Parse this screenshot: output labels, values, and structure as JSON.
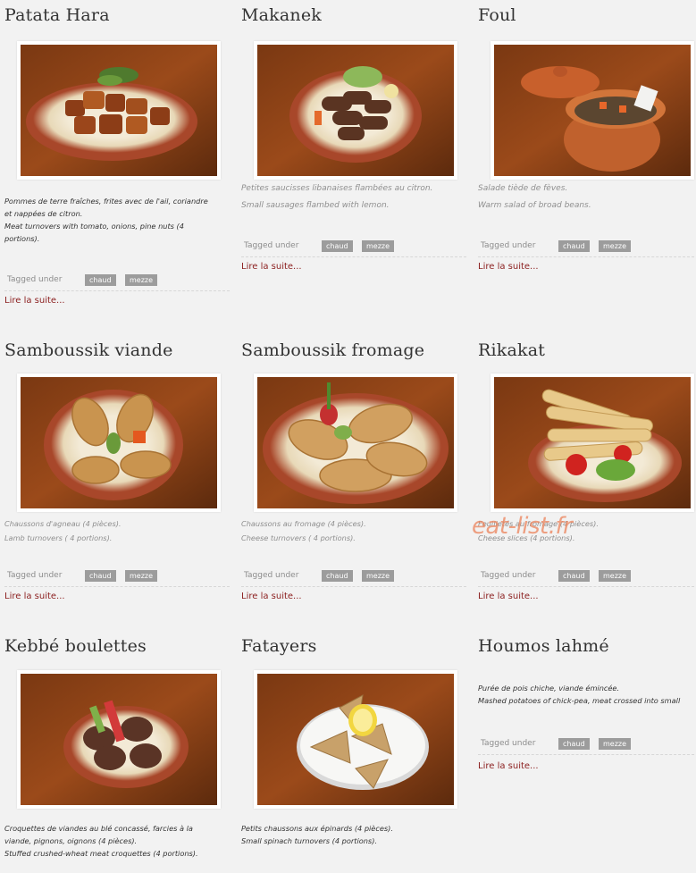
{
  "tag_prefix": "Tagged under",
  "read_more": "Lire la suite...",
  "watermark": "eat-list.fr",
  "colors": {
    "link": "#8b1e1e",
    "tag_bg": "#9c9c9c",
    "tag_text": "#ffffff"
  },
  "dishes": [
    {
      "title": "Patata Hara",
      "desc": [
        "Pommes de terre fraîches, frites avec de l'ail, coriandre",
        "et nappées de citron.",
        "Meat turnovers with tomato, onions, pine nuts (4",
        "portions)."
      ],
      "tags": [
        "chaud",
        "mezze"
      ]
    },
    {
      "title": "Makanek",
      "desc": [
        "Petites saucisses libanaises flambées au citron.",
        "Small sausages flambed with lemon."
      ],
      "tags": [
        "chaud",
        "mezze"
      ]
    },
    {
      "title": "Foul",
      "desc": [
        "Salade tiède de fèves.",
        "Warm salad of broad beans."
      ],
      "tags": [
        "chaud",
        "mezze"
      ]
    },
    {
      "title": "Samboussik viande",
      "desc": [
        "Chaussons d'agneau (4 pièces).",
        "Lamb turnovers ( 4 portions)."
      ],
      "tags": [
        "chaud",
        "mezze"
      ]
    },
    {
      "title": "Samboussik fromage",
      "desc": [
        "Chaussons au fromage (4 pièces).",
        "Cheese turnovers ( 4 portions)."
      ],
      "tags": [
        "chaud",
        "mezze"
      ]
    },
    {
      "title": "Rikakat",
      "desc": [
        "Feuilletés au fromage (4 pièces).",
        "Cheese slices (4 portions)."
      ],
      "tags": [
        "chaud",
        "mezze"
      ]
    },
    {
      "title": "Kebbé boulettes",
      "desc": [
        "Croquettes de viandes au blé concassé, farcies à la",
        "viande, pignons, oignons (4 pièces).",
        "Stuffed crushed-wheat meat croquettes (4 portions)."
      ],
      "tags": []
    },
    {
      "title": "Fatayers",
      "desc": [
        "Petits chaussons aux épinards (4 pièces).",
        "Small spinach turnovers (4 portions)."
      ],
      "tags": []
    },
    {
      "title": "Houmos lahmé",
      "desc": [
        "Purée de pois chiche, viande émincée.",
        "Mashed potatoes of chick-pea, meat crossed into small"
      ],
      "tags": [
        "chaud",
        "mezze"
      ]
    }
  ]
}
